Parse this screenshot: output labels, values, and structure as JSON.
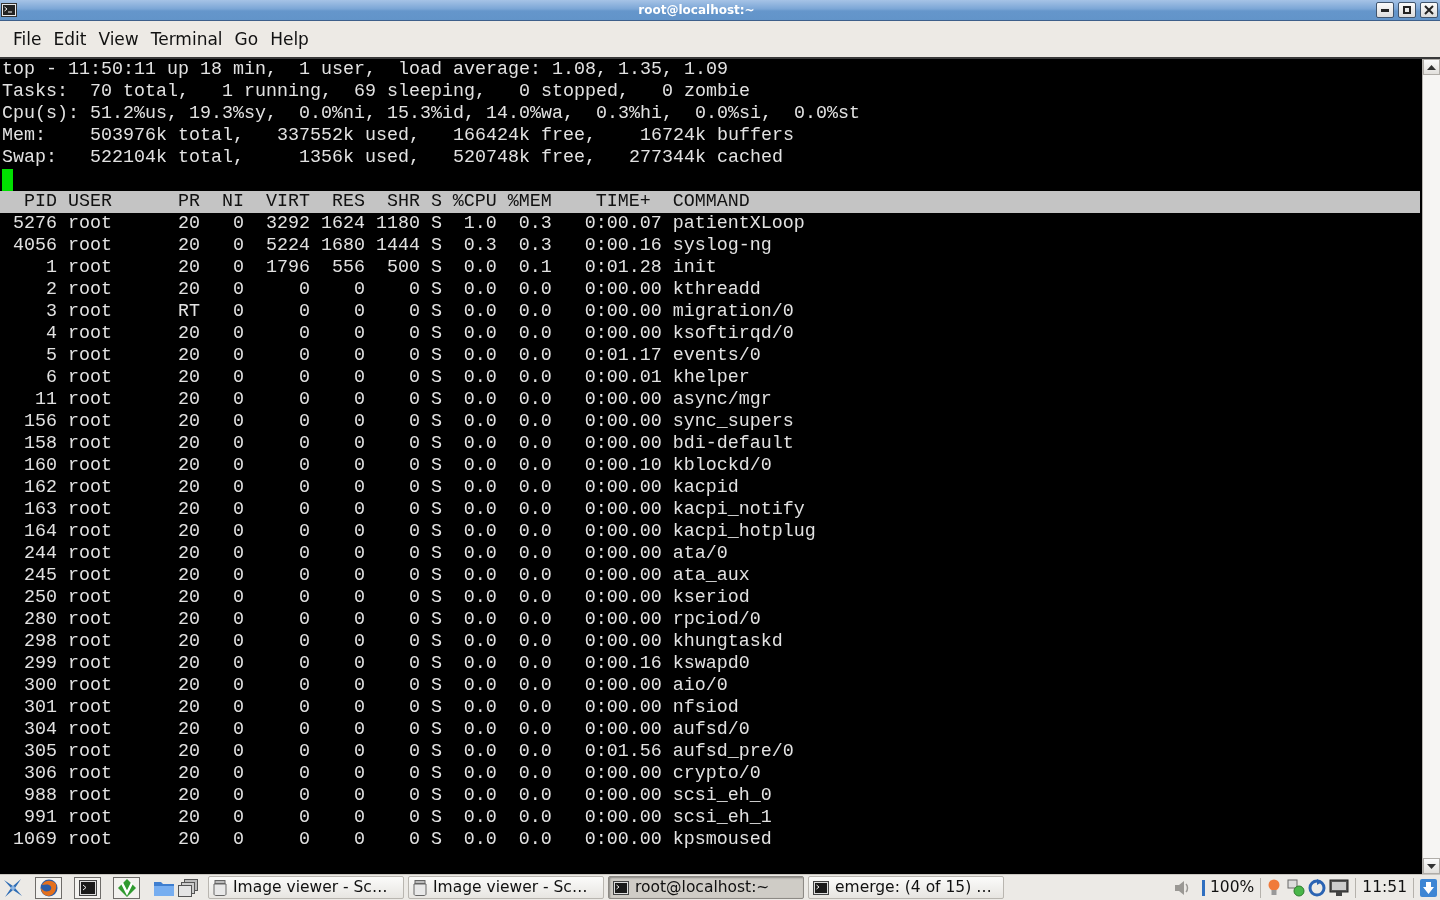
{
  "window": {
    "title": "root@localhost:~"
  },
  "menu": [
    "File",
    "Edit",
    "View",
    "Terminal",
    "Go",
    "Help"
  ],
  "terminal": {
    "summary": [
      "top - 11:50:11 up 18 min,  1 user,  load average: 1.08, 1.35, 1.09",
      "Tasks:  70 total,   1 running,  69 sleeping,   0 stopped,   0 zombie",
      "Cpu(s): 51.2%us, 19.3%sy,  0.0%ni, 15.3%id, 14.0%wa,  0.3%hi,  0.0%si,  0.0%st",
      "Mem:    503976k total,   337552k used,   166424k free,    16724k buffers",
      "Swap:   522104k total,     1356k used,   520748k free,   277344k cached"
    ],
    "table": {
      "columns": [
        "PID",
        "USER",
        "PR",
        "NI",
        "VIRT",
        "RES",
        "SHR",
        "S",
        "%CPU",
        "%MEM",
        "TIME+",
        "COMMAND"
      ],
      "rows": [
        [
          "5276",
          "root",
          "20",
          "0",
          "3292",
          "1624",
          "1180",
          "S",
          "1.0",
          "0.3",
          "0:00.07",
          "patientXLoop"
        ],
        [
          "4056",
          "root",
          "20",
          "0",
          "5224",
          "1680",
          "1444",
          "S",
          "0.3",
          "0.3",
          "0:00.16",
          "syslog-ng"
        ],
        [
          "1",
          "root",
          "20",
          "0",
          "1796",
          "556",
          "500",
          "S",
          "0.0",
          "0.1",
          "0:01.28",
          "init"
        ],
        [
          "2",
          "root",
          "20",
          "0",
          "0",
          "0",
          "0",
          "S",
          "0.0",
          "0.0",
          "0:00.00",
          "kthreadd"
        ],
        [
          "3",
          "root",
          "RT",
          "0",
          "0",
          "0",
          "0",
          "S",
          "0.0",
          "0.0",
          "0:00.00",
          "migration/0"
        ],
        [
          "4",
          "root",
          "20",
          "0",
          "0",
          "0",
          "0",
          "S",
          "0.0",
          "0.0",
          "0:00.00",
          "ksoftirqd/0"
        ],
        [
          "5",
          "root",
          "20",
          "0",
          "0",
          "0",
          "0",
          "S",
          "0.0",
          "0.0",
          "0:01.17",
          "events/0"
        ],
        [
          "6",
          "root",
          "20",
          "0",
          "0",
          "0",
          "0",
          "S",
          "0.0",
          "0.0",
          "0:00.01",
          "khelper"
        ],
        [
          "11",
          "root",
          "20",
          "0",
          "0",
          "0",
          "0",
          "S",
          "0.0",
          "0.0",
          "0:00.00",
          "async/mgr"
        ],
        [
          "156",
          "root",
          "20",
          "0",
          "0",
          "0",
          "0",
          "S",
          "0.0",
          "0.0",
          "0:00.00",
          "sync_supers"
        ],
        [
          "158",
          "root",
          "20",
          "0",
          "0",
          "0",
          "0",
          "S",
          "0.0",
          "0.0",
          "0:00.00",
          "bdi-default"
        ],
        [
          "160",
          "root",
          "20",
          "0",
          "0",
          "0",
          "0",
          "S",
          "0.0",
          "0.0",
          "0:00.10",
          "kblockd/0"
        ],
        [
          "162",
          "root",
          "20",
          "0",
          "0",
          "0",
          "0",
          "S",
          "0.0",
          "0.0",
          "0:00.00",
          "kacpid"
        ],
        [
          "163",
          "root",
          "20",
          "0",
          "0",
          "0",
          "0",
          "S",
          "0.0",
          "0.0",
          "0:00.00",
          "kacpi_notify"
        ],
        [
          "164",
          "root",
          "20",
          "0",
          "0",
          "0",
          "0",
          "S",
          "0.0",
          "0.0",
          "0:00.00",
          "kacpi_hotplug"
        ],
        [
          "244",
          "root",
          "20",
          "0",
          "0",
          "0",
          "0",
          "S",
          "0.0",
          "0.0",
          "0:00.00",
          "ata/0"
        ],
        [
          "245",
          "root",
          "20",
          "0",
          "0",
          "0",
          "0",
          "S",
          "0.0",
          "0.0",
          "0:00.00",
          "ata_aux"
        ],
        [
          "250",
          "root",
          "20",
          "0",
          "0",
          "0",
          "0",
          "S",
          "0.0",
          "0.0",
          "0:00.00",
          "kseriod"
        ],
        [
          "280",
          "root",
          "20",
          "0",
          "0",
          "0",
          "0",
          "S",
          "0.0",
          "0.0",
          "0:00.00",
          "rpciod/0"
        ],
        [
          "298",
          "root",
          "20",
          "0",
          "0",
          "0",
          "0",
          "S",
          "0.0",
          "0.0",
          "0:00.00",
          "khungtaskd"
        ],
        [
          "299",
          "root",
          "20",
          "0",
          "0",
          "0",
          "0",
          "S",
          "0.0",
          "0.0",
          "0:00.16",
          "kswapd0"
        ],
        [
          "300",
          "root",
          "20",
          "0",
          "0",
          "0",
          "0",
          "S",
          "0.0",
          "0.0",
          "0:00.00",
          "aio/0"
        ],
        [
          "301",
          "root",
          "20",
          "0",
          "0",
          "0",
          "0",
          "S",
          "0.0",
          "0.0",
          "0:00.00",
          "nfsiod"
        ],
        [
          "304",
          "root",
          "20",
          "0",
          "0",
          "0",
          "0",
          "S",
          "0.0",
          "0.0",
          "0:00.00",
          "aufsd/0"
        ],
        [
          "305",
          "root",
          "20",
          "0",
          "0",
          "0",
          "0",
          "S",
          "0.0",
          "0.0",
          "0:01.56",
          "aufsd_pre/0"
        ],
        [
          "306",
          "root",
          "20",
          "0",
          "0",
          "0",
          "0",
          "S",
          "0.0",
          "0.0",
          "0:00.00",
          "crypto/0"
        ],
        [
          "988",
          "root",
          "20",
          "0",
          "0",
          "0",
          "0",
          "S",
          "0.0",
          "0.0",
          "0:00.00",
          "scsi_eh_0"
        ],
        [
          "991",
          "root",
          "20",
          "0",
          "0",
          "0",
          "0",
          "S",
          "0.0",
          "0.0",
          "0:00.00",
          "scsi_eh_1"
        ],
        [
          "1069",
          "root",
          "20",
          "0",
          "0",
          "0",
          "0",
          "S",
          "0.0",
          "0.0",
          "0:00.00",
          "kpsmoused"
        ]
      ]
    }
  },
  "taskbar": {
    "tasks": [
      {
        "kind": "viewer",
        "label": "Image viewer - Sc…",
        "selected": false
      },
      {
        "kind": "viewer",
        "label": "Image viewer - Sc…",
        "selected": false
      },
      {
        "kind": "terminal",
        "label": "root@localhost:~",
        "selected": true
      },
      {
        "kind": "terminal",
        "label": "emerge: (4 of 15) …",
        "selected": false
      }
    ],
    "battery": "100%",
    "clock": "11:51"
  }
}
